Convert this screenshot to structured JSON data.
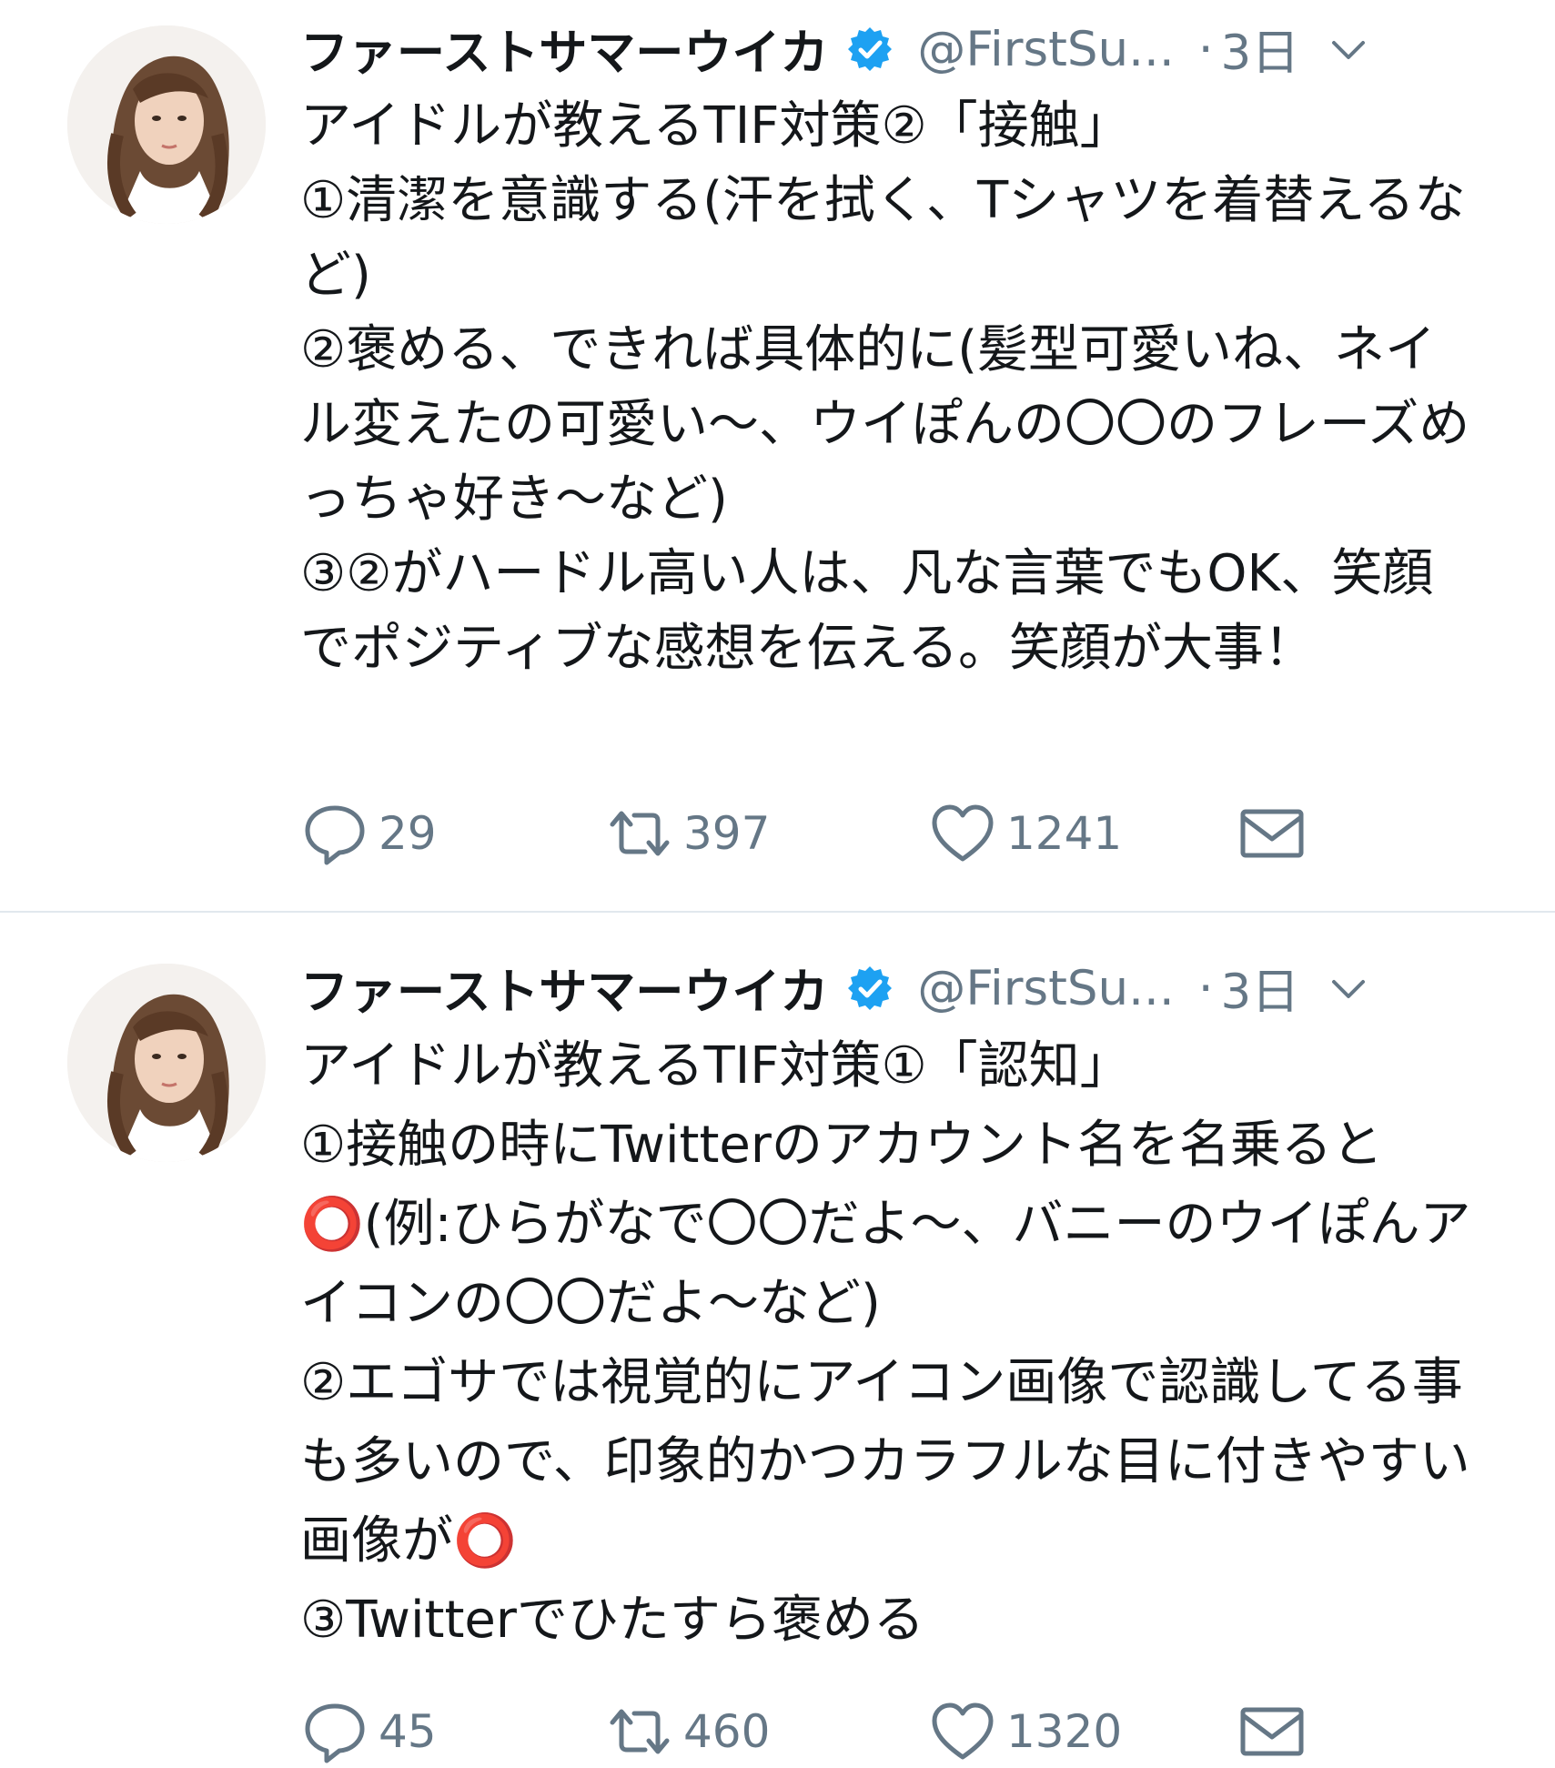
{
  "colors": {
    "text": "#14171a",
    "secondary": "#657786",
    "verified": "#1da1f2",
    "divider": "#e1e8ed",
    "red_circle": "#e0202e"
  },
  "tweets": [
    {
      "author_name": "ファーストサマーウイカ",
      "verified_icon": "verified-badge-icon",
      "handle": "@FirstSu...",
      "dot": "·",
      "time": "3日",
      "body": "アイドルが教えるTIF対策②「接触」\n①清潔を意識する(汗を拭く、Tシャツを着替えるなど)\n②褒める、できれば具体的に(髪型可愛いね、ネイル変えたの可愛い〜、ウイぽんの〇〇のフレーズめっちゃ好き〜など)\n③②がハードル高い人は、凡な言葉でもOK、笑顔でポジティブな感想を伝える。笑顔が大事！",
      "replies": "29",
      "retweets": "397",
      "likes": "1241"
    },
    {
      "author_name": "ファーストサマーウイカ",
      "verified_icon": "verified-badge-icon",
      "handle": "@FirstSu...",
      "dot": "·",
      "time": "3日",
      "body": "アイドルが教えるTIF対策①「認知」\n①接触の時にTwitterのアカウント名を名乗ると⭕(例:ひらがなで〇〇だよ〜、バニーのウイぽんアイコンの〇〇だよ〜など)\n②エゴサでは視覚的にアイコン画像で認識してる事も多いので、印象的かつカラフルな目に付きやすい画像が⭕\n③Twitterでひたすら褒める",
      "replies": "45",
      "retweets": "460",
      "likes": "1320"
    }
  ]
}
